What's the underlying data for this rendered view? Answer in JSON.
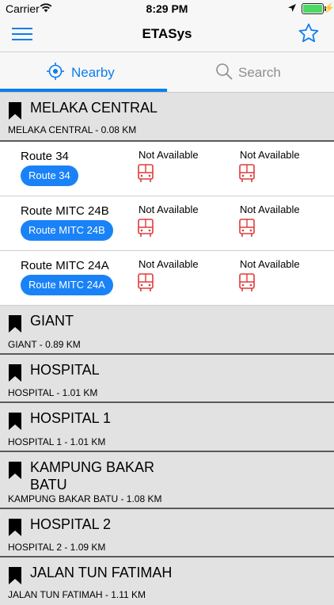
{
  "status_bar": {
    "carrier": "Carrier",
    "time": "8:29 PM"
  },
  "nav": {
    "title": "ETASys"
  },
  "tabs": [
    {
      "label": "Nearby",
      "active": true
    },
    {
      "label": "Search",
      "active": false
    }
  ],
  "colors": {
    "accent": "#0b7df0",
    "pill": "#1a82f7",
    "bus_icon": "#e03a3a",
    "header_bg": "#e2e2e2"
  },
  "stops": [
    {
      "name": "MELAKA CENTRAL",
      "distance": "MELAKA CENTRAL - 0.08 KM",
      "expanded": true,
      "routes": [
        {
          "name": "Route 34",
          "pill": "Route 34",
          "eta1": "Not Available",
          "eta2": "Not Available"
        },
        {
          "name": "Route MITC 24B",
          "pill": "Route MITC 24B",
          "eta1": "Not Available",
          "eta2": "Not Available"
        },
        {
          "name": "Route MITC 24A",
          "pill": "Route MITC 24A",
          "eta1": "Not Available",
          "eta2": "Not Available"
        }
      ]
    },
    {
      "name": "GIANT",
      "distance": "GIANT - 0.89 KM"
    },
    {
      "name": "HOSPITAL",
      "distance": "HOSPITAL - 1.01 KM"
    },
    {
      "name": "HOSPITAL 1",
      "distance": "HOSPITAL 1 - 1.01 KM"
    },
    {
      "name": "KAMPUNG BAKAR BATU",
      "distance": "KAMPUNG BAKAR BATU - 1.08 KM"
    },
    {
      "name": "HOSPITAL 2",
      "distance": "HOSPITAL 2 - 1.09 KM"
    },
    {
      "name": "JALAN TUN FATIMAH",
      "distance": "JALAN TUN FATIMAH - 1.11 KM"
    }
  ]
}
